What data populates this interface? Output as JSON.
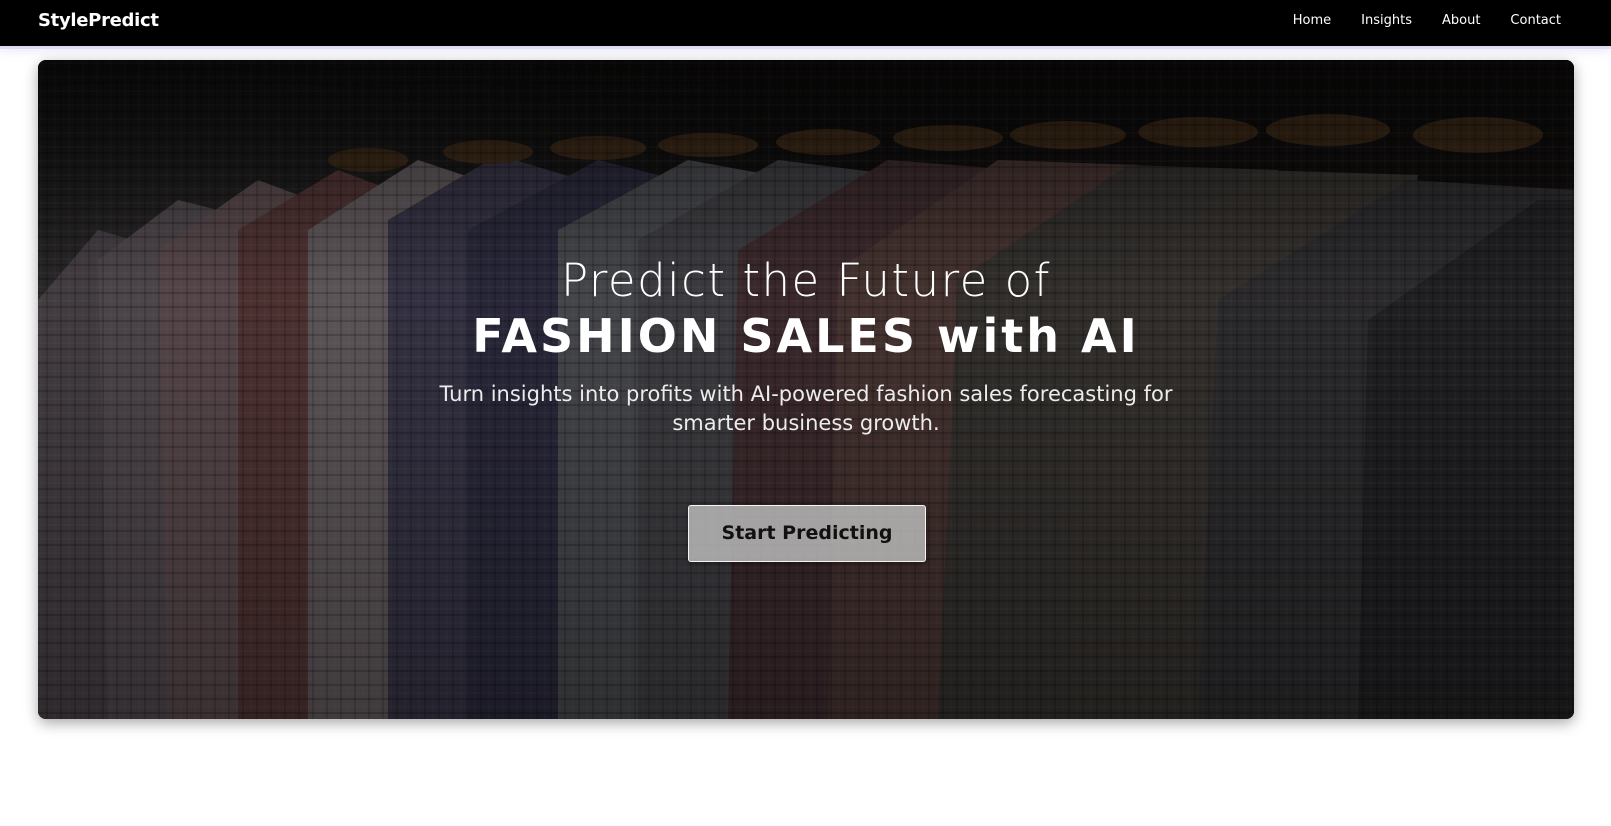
{
  "navbar": {
    "brand": "StylePredict",
    "links": [
      "Home",
      "Insights",
      "About",
      "Contact"
    ]
  },
  "hero": {
    "headline_line1": "Predict the Future of",
    "headline_line2": "FASHION SALES with AI",
    "subtitle": "Turn insights into profits with AI-powered fashion sales forecasting for smarter business growth.",
    "cta_label": "Start Predicting",
    "background_image": "shirts-on-hangers-rack-photo"
  },
  "colors": {
    "navbar_bg": "#000000",
    "text": "#ffffff",
    "button_bg": "#bebebe",
    "button_text": "#111111"
  }
}
